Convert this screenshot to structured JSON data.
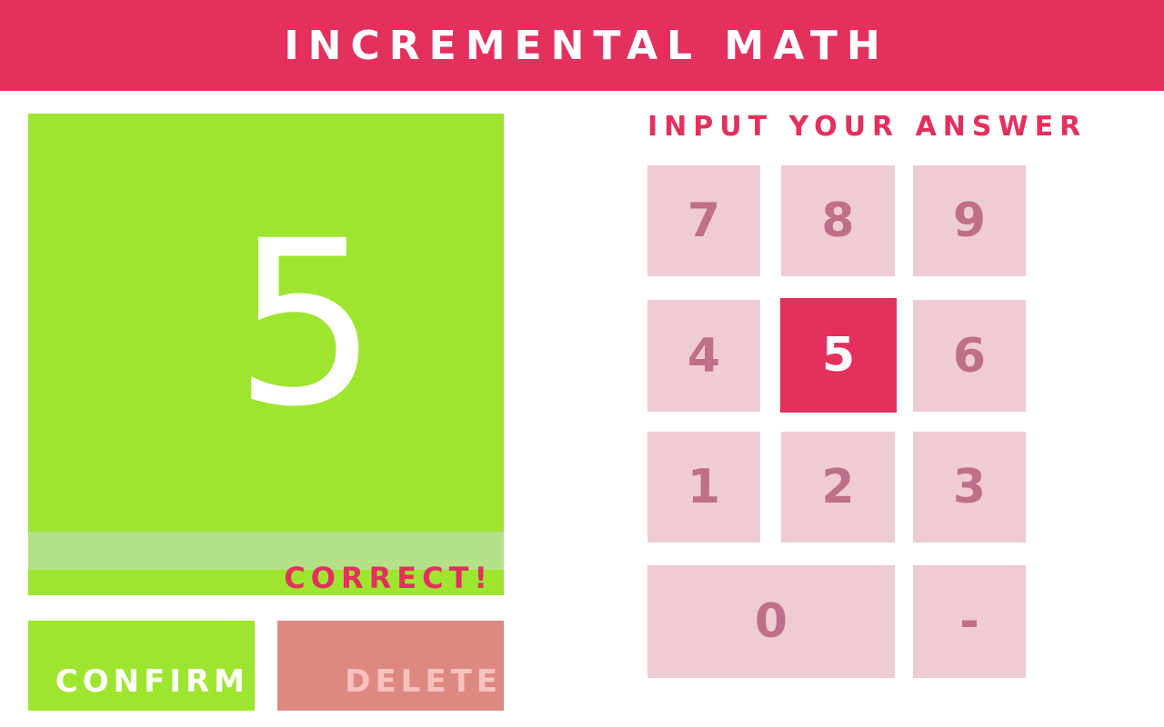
{
  "header": {
    "title": "INCREMENTAL MATH"
  },
  "display": {
    "value": "5",
    "feedback": "CORRECT!"
  },
  "actions": {
    "confirm_label": "CONFIRM",
    "delete_label": "DELETE"
  },
  "keypad": {
    "prompt": "INPUT YOUR ANSWER",
    "selected_key": "5",
    "keys": {
      "k7": "7",
      "k8": "8",
      "k9": "9",
      "k4": "4",
      "k5": "5",
      "k6": "6",
      "k1": "1",
      "k2": "2",
      "k3": "3",
      "k0": "0",
      "kminus": "-"
    }
  },
  "colors": {
    "accent": "#e3305d",
    "success": "#9ee52f",
    "key_bg": "#efcbd3",
    "key_text": "#bf6f88",
    "delete_bg": "#dd8981"
  }
}
